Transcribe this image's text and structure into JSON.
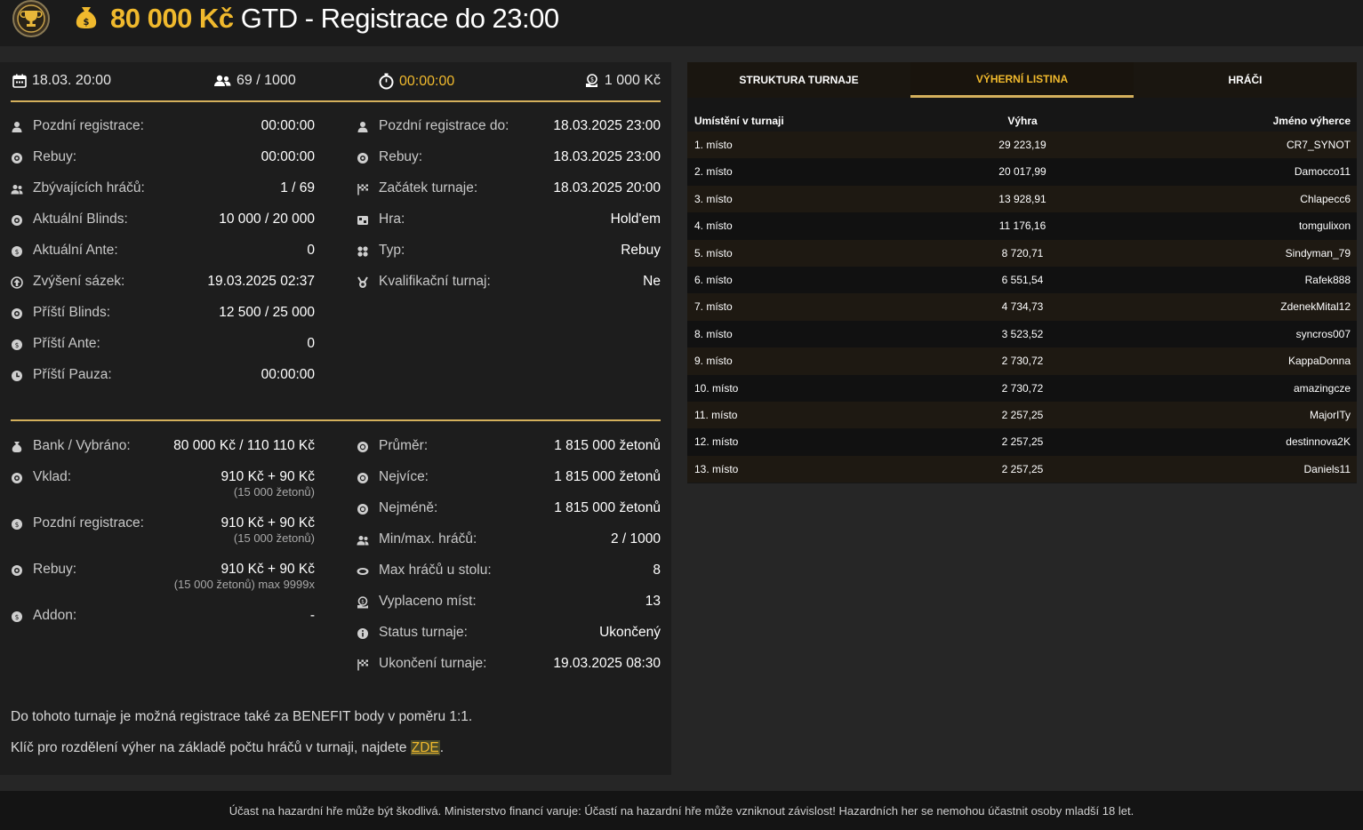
{
  "header": {
    "prize": "80 000 Kč",
    "title": "GTD - Registrace do 23:00"
  },
  "top_stats": {
    "date": "18.03. 20:00",
    "players": "69 / 1000",
    "timer": "00:00:00",
    "buyin": "1 000 Kč"
  },
  "left_details": [
    {
      "label": "Pozdní registrace:",
      "value": "00:00:00",
      "icon": "user-icon"
    },
    {
      "label": "Rebuy:",
      "value": "00:00:00",
      "icon": "chips-icon"
    },
    {
      "label": "Zbývajících hráčů:",
      "value": "1 / 69",
      "icon": "users-icon"
    },
    {
      "label": "Aktuální Blinds:",
      "value": "10 000 / 20 000",
      "icon": "chips-icon"
    },
    {
      "label": "Aktuální Ante:",
      "value": "0",
      "icon": "coin-icon"
    },
    {
      "label": "Zvýšení sázek:",
      "value": "19.03.2025 02:37",
      "icon": "arrow-up-icon"
    },
    {
      "label": "Příští Blinds:",
      "value": "12 500 / 25 000",
      "icon": "chips-icon"
    },
    {
      "label": "Příští Ante:",
      "value": "0",
      "icon": "coin-icon"
    },
    {
      "label": "Příští Pauza:",
      "value": "00:00:00",
      "icon": "clock-icon"
    }
  ],
  "right_details": [
    {
      "label": "Pozdní registrace do:",
      "value": "18.03.2025 23:00",
      "icon": "user-icon"
    },
    {
      "label": "Rebuy:",
      "value": "18.03.2025 23:00",
      "icon": "chips-icon"
    },
    {
      "label": "Začátek turnaje:",
      "value": "18.03.2025 20:00",
      "icon": "flag-icon"
    },
    {
      "label": "Hra:",
      "value": "Hold'em",
      "icon": "cards-icon"
    },
    {
      "label": "Typ:",
      "value": "Rebuy",
      "icon": "suits-icon"
    },
    {
      "label": "Kvalifikační turnaj:",
      "value": "Ne",
      "icon": "medal-icon"
    }
  ],
  "bank": {
    "label": "Bank / Vybráno:",
    "value": "80 000 Kč / 110 110 Kč",
    "deposit_label": "Vklad:",
    "deposit_value": "910 Kč + 90 Kč",
    "deposit_sub": "(15 000 žetonů)",
    "late_label": "Pozdní registrace:",
    "late_value": "910 Kč + 90 Kč",
    "late_sub": "(15 000 žetonů)",
    "rebuy_label": "Rebuy:",
    "rebuy_value": "910 Kč + 90 Kč",
    "rebuy_sub": "(15 000 žetonů) max 9999x",
    "addon_label": "Addon:",
    "addon_value": "-"
  },
  "stats_right": [
    {
      "label": "Průměr:",
      "value": "1 815 000 žetonů",
      "icon": "chip-icon"
    },
    {
      "label": "Nejvíce:",
      "value": "1 815 000 žetonů",
      "icon": "chip-icon"
    },
    {
      "label": "Nejméně:",
      "value": "1 815 000 žetonů",
      "icon": "chip-icon"
    },
    {
      "label": "Min/max. hráčů:",
      "value": "2 / 1000",
      "icon": "users-icon"
    },
    {
      "label": "Max hráčů u stolu:",
      "value": "8",
      "icon": "table-icon"
    },
    {
      "label": "Vyplaceno míst:",
      "value": "13",
      "icon": "payout-icon"
    },
    {
      "label": "Status turnaje:",
      "value": "Ukončený",
      "icon": "info-icon"
    },
    {
      "label": "Ukončení turnaje:",
      "value": "19.03.2025 08:30",
      "icon": "flag-icon"
    }
  ],
  "notes": {
    "benefit": "Do tohoto turnaje je možná registrace také za BENEFIT body v poměru 1:1.",
    "key_prefix": "Klíč pro rozdělení výher na základě počtu hráčů v turnaji, najdete ",
    "key_link": "ZDE",
    "key_suffix": "."
  },
  "tabs": [
    "STRUKTURA TURNAJE",
    "VÝHERNÍ LISTINA",
    "HRÁČI"
  ],
  "active_tab": "VÝHERNÍ LISTINA",
  "table": {
    "headers": [
      "Umístění v turnaji",
      "Výhra",
      "Jméno výherce"
    ],
    "rows": [
      [
        "1. místo",
        "29 223,19",
        "CR7_SYNOT"
      ],
      [
        "2. místo",
        "20 017,99",
        "Damocco11"
      ],
      [
        "3. místo",
        "13 928,91",
        "Chlapecc6"
      ],
      [
        "4. místo",
        "11 176,16",
        "tomgulixon"
      ],
      [
        "5. místo",
        "8 720,71",
        "Sindyman_79"
      ],
      [
        "6. místo",
        "6 551,54",
        "Rafek888"
      ],
      [
        "7. místo",
        "4 734,73",
        "ZdenekMital12"
      ],
      [
        "8. místo",
        "3 523,52",
        "syncros007"
      ],
      [
        "9. místo",
        "2 730,72",
        "KappaDonna"
      ],
      [
        "10. místo",
        "2 730,72",
        "amazingcze"
      ],
      [
        "11. místo",
        "2 257,25",
        "MajorITy"
      ],
      [
        "12. místo",
        "2 257,25",
        "destinnova2K"
      ],
      [
        "13. místo",
        "2 257,25",
        "Daniels11"
      ]
    ]
  },
  "footer": "Účast na hazardní hře může být škodlivá. Ministerstvo financí varuje: Účastí na hazardní hře může vzniknout závislost! Hazardních her se nemohou účastnit osoby mladší 18 let.",
  "colors": {
    "accent": "#f0b92d",
    "divider": "#d4b05c",
    "panel": "#1d1d1d",
    "background": "#262626"
  }
}
